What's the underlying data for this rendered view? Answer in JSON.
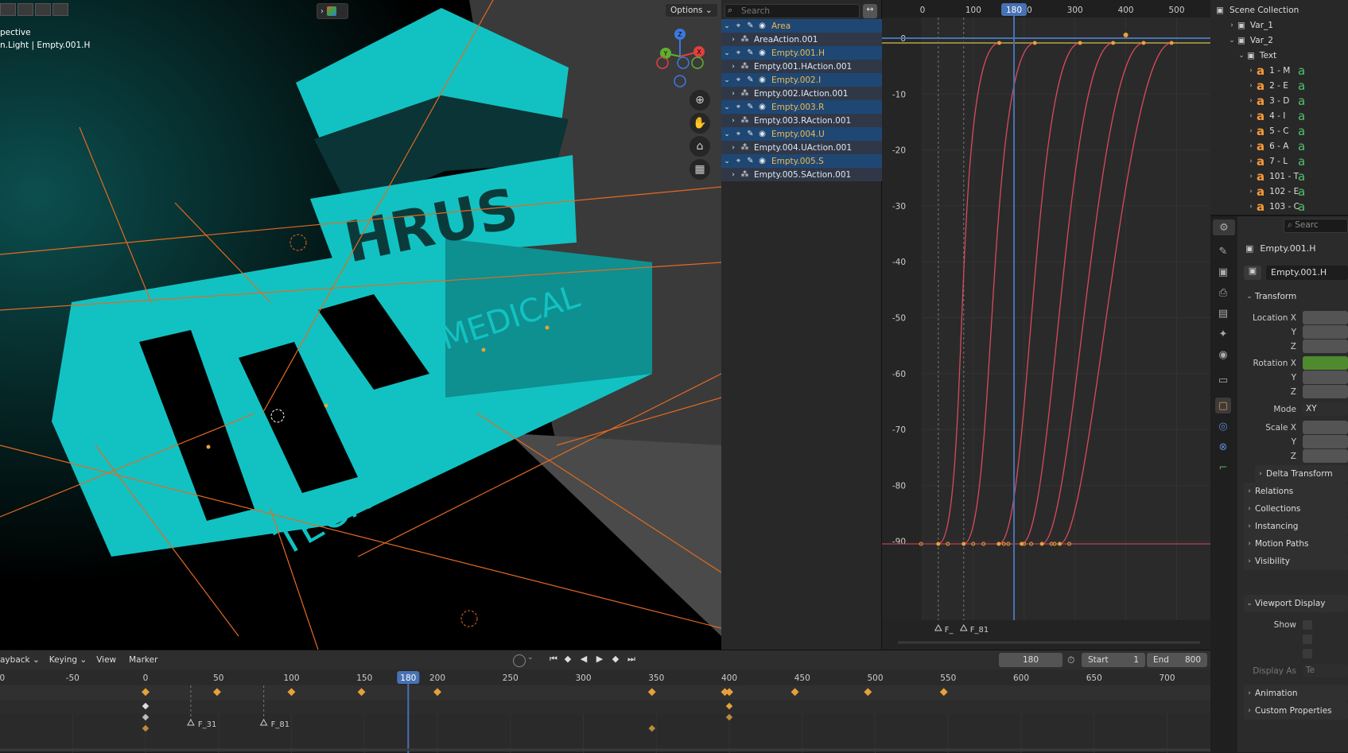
{
  "viewport": {
    "view_name": "pective",
    "object_info": "n.Light | Empty.001.H",
    "options_label": "Options",
    "gizmo_axes": {
      "z": "Z",
      "x": "X",
      "y": "Y"
    },
    "scene_words": {
      "back_word": "HRUS",
      "front_word": "MEDICAL",
      "tech_word": "TECHNOLOGY"
    }
  },
  "channels": {
    "search_placeholder": "Search",
    "rows": [
      {
        "label": "Area",
        "type": "object"
      },
      {
        "label": "AreaAction.001",
        "type": "action"
      },
      {
        "label": "Empty.001.H",
        "type": "object"
      },
      {
        "label": "Empty.001.HAction.001",
        "type": "action"
      },
      {
        "label": "Empty.002.I",
        "type": "object"
      },
      {
        "label": "Empty.002.IAction.001",
        "type": "action"
      },
      {
        "label": "Empty.003.R",
        "type": "object"
      },
      {
        "label": "Empty.003.RAction.001",
        "type": "action"
      },
      {
        "label": "Empty.004.U",
        "type": "object"
      },
      {
        "label": "Empty.004.UAction.001",
        "type": "action"
      },
      {
        "label": "Empty.005.S",
        "type": "object"
      },
      {
        "label": "Empty.005.SAction.001",
        "type": "action"
      }
    ]
  },
  "graph": {
    "x_ticks": [
      "0",
      "100",
      "200",
      "300",
      "400",
      "500"
    ],
    "current_frame": "180",
    "y_ticks": [
      "0",
      "-10",
      "-20",
      "-30",
      "-40",
      "-50",
      "-60",
      "-70",
      "-80",
      "-90"
    ],
    "markers": [
      "F_",
      "F_81"
    ]
  },
  "outliner": {
    "title": "Scene Collection",
    "items": [
      {
        "label": "Var_1",
        "depth": 1,
        "expanded": false,
        "kind": "collection"
      },
      {
        "label": "Var_2",
        "depth": 1,
        "expanded": true,
        "kind": "collection"
      },
      {
        "label": "Text",
        "depth": 2,
        "expanded": true,
        "kind": "collection"
      },
      {
        "label": "1 - M",
        "depth": 3,
        "kind": "text"
      },
      {
        "label": "2 - E",
        "depth": 3,
        "kind": "text"
      },
      {
        "label": "3 - D",
        "depth": 3,
        "kind": "text"
      },
      {
        "label": "4 - I",
        "depth": 3,
        "kind": "text"
      },
      {
        "label": "5 - C",
        "depth": 3,
        "kind": "text"
      },
      {
        "label": "6 - A",
        "depth": 3,
        "kind": "text"
      },
      {
        "label": "7 - L",
        "depth": 3,
        "kind": "text"
      },
      {
        "label": "101 - T",
        "depth": 3,
        "kind": "text"
      },
      {
        "label": "102 - E",
        "depth": 3,
        "kind": "text"
      },
      {
        "label": "103 - C",
        "depth": 3,
        "kind": "text"
      }
    ]
  },
  "properties": {
    "search_placeholder": "Searc",
    "object_name": "Empty.001.H",
    "datablock_name": "Empty.001.H",
    "transform_header": "Transform",
    "location_label": "Location X",
    "rotation_label": "Rotation X",
    "mode_label": "Mode",
    "mode_value": "XY",
    "scale_label": "Scale X",
    "axis_y": "Y",
    "axis_z": "Z",
    "delta_transform": "Delta Transform",
    "panels": [
      "Relations",
      "Collections",
      "Instancing",
      "Motion Paths",
      "Visibility"
    ],
    "viewport_display": "Viewport Display",
    "show_label": "Show",
    "display_as_label": "Display As",
    "display_as_value": "Te",
    "animation": "Animation",
    "custom_properties": "Custom Properties"
  },
  "timeline": {
    "menus": [
      "ayback",
      "Keying",
      "View",
      "Marker"
    ],
    "current_frame": "180",
    "start_label": "Start",
    "start_value": "1",
    "end_label": "End",
    "end_value": "800",
    "ruler": [
      "00",
      "-50",
      "0",
      "50",
      "100",
      "150",
      "200",
      "250",
      "300",
      "350",
      "400",
      "450",
      "500",
      "550",
      "600",
      "650",
      "700"
    ],
    "markers": [
      "F_31",
      "F_81"
    ]
  },
  "colors": {
    "accent_blue": "#4772b3",
    "teal": "#14c6c6",
    "keyframe": "#e8a13a",
    "curve": "#d94a5b",
    "orange_line": "#e36a21",
    "object_row": "#1f4774",
    "green_field": "#4f8a2f"
  }
}
